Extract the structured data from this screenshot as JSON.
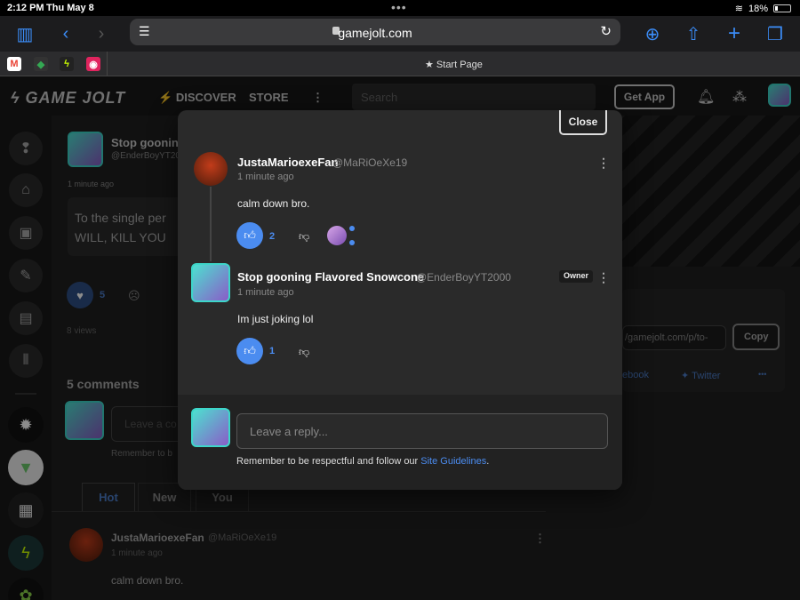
{
  "status_bar": {
    "time": "2:12 PM",
    "date": "Thu May 8",
    "battery": "18%"
  },
  "browser": {
    "url": "gamejolt.com",
    "active_tab_title": "Start Page",
    "icons": [
      "sidebar-icon",
      "back-icon",
      "forward-icon",
      "reader-icon",
      "reload-icon",
      "download-icon",
      "share-icon",
      "new-tab-icon",
      "tabs-icon"
    ]
  },
  "header": {
    "logo": "GAME JOLT",
    "nav": [
      "DISCOVER",
      "STORE"
    ],
    "search_placeholder": "Search",
    "get_app": "Get App"
  },
  "background": {
    "post_author": "Stop gooning",
    "post_handle": "@EnderBoyYT2000",
    "post_time": "1 minute ago",
    "post_text_line1": "To the single per",
    "post_text_line2": "WILL, KILL YOU",
    "like_count": "5",
    "views": "8 views",
    "comments_count": "5 comments",
    "comment_placeholder": "Leave a co",
    "remember": "Remember to b",
    "tabs": [
      "Hot",
      "New",
      "You"
    ],
    "share_url": "/gamejolt.com/p/to-",
    "copy": "Copy",
    "facebook": "ebook",
    "twitter": "Twitter",
    "more": "•••",
    "bottom_comment_author": "JustaMarioexeFan",
    "bottom_comment_handle": "@MaRiOeXe19",
    "bottom_comment_time": "1 minute ago",
    "bottom_comment_text": "calm down bro."
  },
  "modal": {
    "close": "Close",
    "comments": [
      {
        "author": "JustaMarioexeFan",
        "handle": "@MaRiOeXe19",
        "time": "1 minute ago",
        "text": "calm down bro.",
        "likes": "2"
      },
      {
        "author": "Stop gooning Flavored Snowcone",
        "handle": "@EnderBoyYT2000",
        "time": "1 minute ago",
        "text": "Im just joking lol",
        "likes": "1",
        "badge": "Owner"
      }
    ],
    "reply_placeholder": "Leave a reply...",
    "reply_note_prefix": "Remember to be respectful and follow our ",
    "reply_note_link": "Site Guidelines",
    "reply_note_suffix": "."
  }
}
